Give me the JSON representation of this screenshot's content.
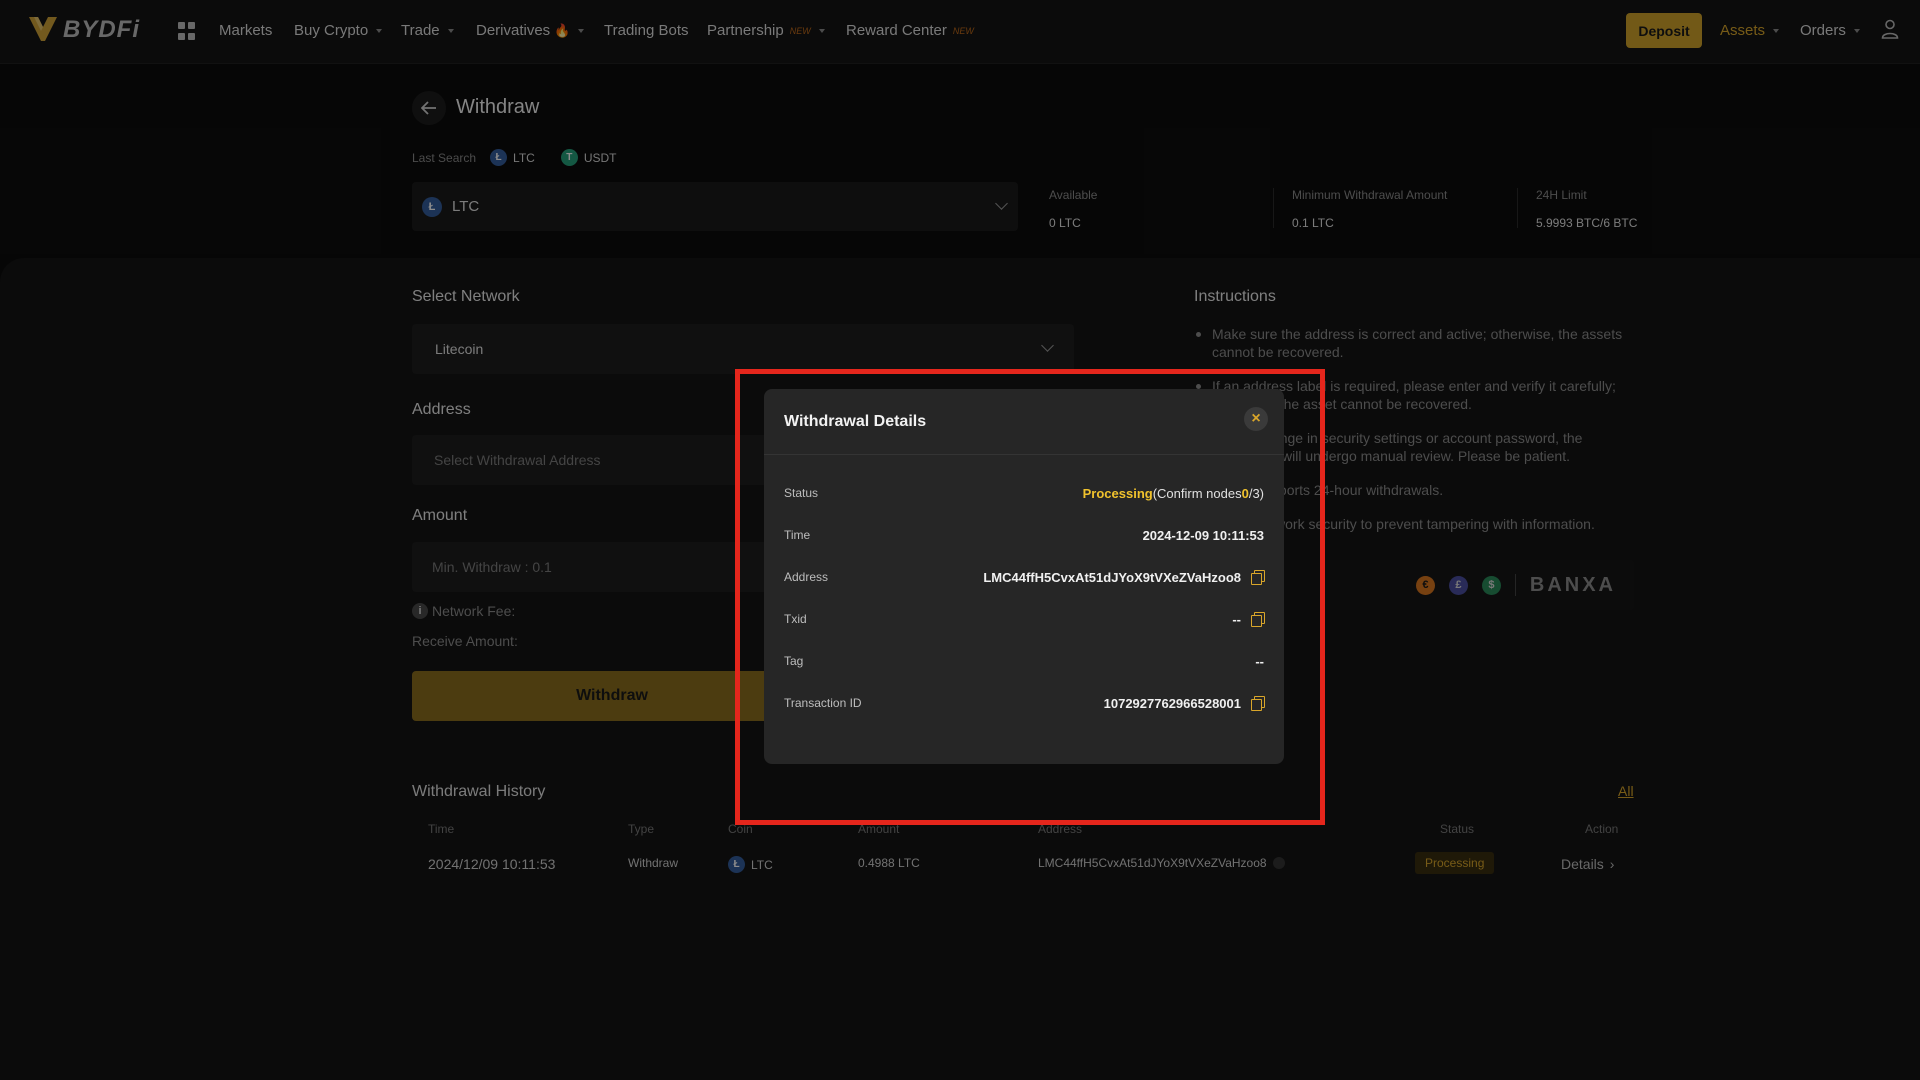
{
  "nav": {
    "logo": "BYDFi",
    "items": [
      {
        "label": "Markets",
        "caret": false
      },
      {
        "label": "Buy Crypto",
        "caret": true
      },
      {
        "label": "Trade",
        "caret": true
      },
      {
        "label": "Derivatives",
        "caret": true
      },
      {
        "label": "Trading Bots",
        "caret": false
      },
      {
        "label": "Partnership",
        "caret": true,
        "tag": "NEW"
      },
      {
        "label": "Reward Center",
        "caret": false,
        "tag": "NEW"
      }
    ],
    "deposit": "Deposit",
    "assets": "Assets",
    "orders": "Orders"
  },
  "page": {
    "title": "Withdraw",
    "last_search_label": "Last Search",
    "last_search": [
      "LTC",
      "USDT"
    ],
    "selected_coin": "LTC",
    "stats": [
      {
        "label": "Available",
        "value": "0 LTC"
      },
      {
        "label": "Minimum Withdrawal Amount",
        "value": "0.1 LTC"
      },
      {
        "label": "24H Limit",
        "value": "5.9993 BTC/6 BTC"
      }
    ]
  },
  "form": {
    "network_title": "Select Network",
    "network_value": "Litecoin",
    "address_title": "Address",
    "address_placeholder": "Select Withdrawal Address",
    "amount_title": "Amount",
    "amount_placeholder": "Min. Withdraw : 0.1",
    "network_fee": "Network Fee:",
    "receive_amount": "Receive Amount:",
    "withdraw_button": "Withdraw"
  },
  "instructions": {
    "title": "Instructions",
    "items": [
      "Make sure the address is correct and active; otherwise, the assets cannot be recovered.",
      "If an address label is required, please enter and verify it carefully; otherwise, the asset cannot be recovered.",
      "After a change in security settings or account password, the withdrawal will undergo manual review. Please be patient.",
      "BYDFi supports 24-hour withdrawals.",
      "Check network security to prevent tampering with information."
    ],
    "partner": "BANXA"
  },
  "history": {
    "title": "Withdrawal History",
    "all_link": "All",
    "columns": [
      "Time",
      "Type",
      "Coin",
      "Amount",
      "Address",
      "Status",
      "Action"
    ],
    "rows": [
      {
        "time": "2024/12/09 10:11:53",
        "type": "Withdraw",
        "coin": "LTC",
        "amount": "0.4988 LTC",
        "address": "LMC44ffH5CvxAt51dJYoX9tVXeZVaHzoo8",
        "status": "Processing",
        "action": "Details"
      }
    ]
  },
  "modal": {
    "title": "Withdrawal Details",
    "status_label": "Status",
    "status_main": "Processing",
    "status_open": "(Confirm nodes",
    "status_nodes": "0",
    "status_close": "/3)",
    "time_label": "Time",
    "time_value": "2024-12-09 10:11:53",
    "address_label": "Address",
    "address_value": "LMC44ffH5CvxAt51dJYoX9tVXeZVaHzoo8",
    "txid_label": "Txid",
    "txid_value": "--",
    "tag_label": "Tag",
    "tag_value": "--",
    "txn_label": "Transaction ID",
    "txn_value": "1072927762966528001"
  },
  "colors": {
    "accent": "#d9a62a",
    "highlight_box": "#e5261c",
    "processing": "#f0c22d"
  }
}
